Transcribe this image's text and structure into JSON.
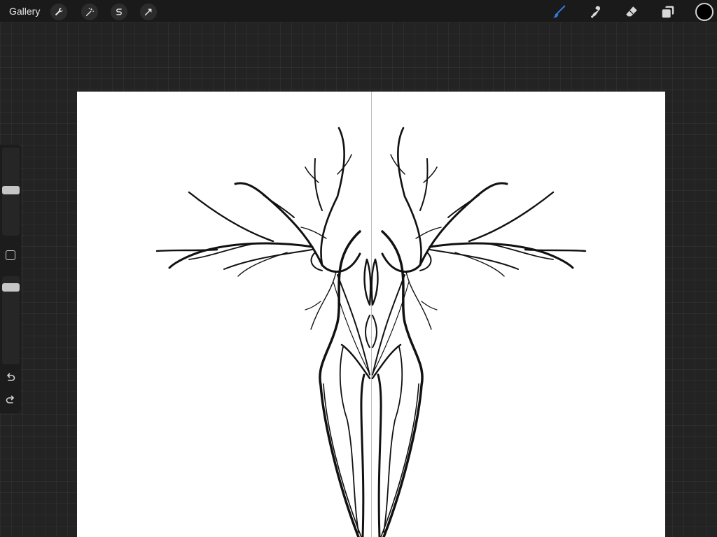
{
  "app": {
    "gallery_label": "Gallery"
  },
  "top_left_tools": [
    {
      "name": "wrench-icon",
      "tool": "actions"
    },
    {
      "name": "magic-wand-icon",
      "tool": "adjustments"
    },
    {
      "name": "selection-s-icon",
      "tool": "selection"
    },
    {
      "name": "transform-arrow-icon",
      "tool": "transform"
    }
  ],
  "top_right_tools": [
    {
      "name": "brush-icon",
      "tool": "paint",
      "active": true,
      "color": "#2f7de1"
    },
    {
      "name": "smudge-icon",
      "tool": "smudge",
      "active": false
    },
    {
      "name": "eraser-icon",
      "tool": "erase",
      "active": false
    },
    {
      "name": "layers-icon",
      "tool": "layers",
      "active": false
    }
  ],
  "current_color": "#000000",
  "sidebar": {
    "brush_size_level": 0.55,
    "opacity_level": 0.9
  },
  "canvas": {
    "background": "#ffffff",
    "symmetry_guide": true
  }
}
